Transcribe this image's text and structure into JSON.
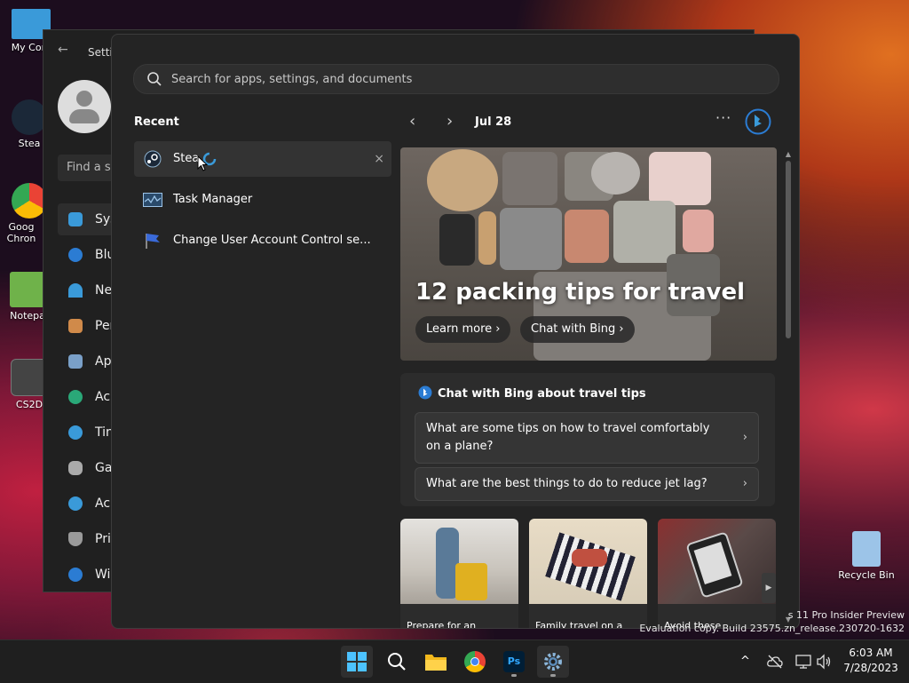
{
  "desktop": {
    "icons": [
      {
        "label": "My Com",
        "color": "#3a9ad9"
      },
      {
        "label": "Stea",
        "color": "#1b2838"
      },
      {
        "label": "Goog Chron",
        "color": "#e0e0e0"
      },
      {
        "label": "Notepa",
        "color": "#6fb24a"
      },
      {
        "label": "CS2D",
        "color": "#444444"
      },
      {
        "label": "Recycle Bin",
        "color": "#9cc4e8"
      }
    ]
  },
  "settings_window": {
    "title": "Setti",
    "find_placeholder": "Find a se",
    "nav": [
      {
        "label": "Sys",
        "color": "#3a9ad9"
      },
      {
        "label": "Blu",
        "color": "#2b7cd3"
      },
      {
        "label": "Ne",
        "color": "#3a9ad9"
      },
      {
        "label": "Per",
        "color": "#d08a4a"
      },
      {
        "label": "Ap",
        "color": "#7aa0c8"
      },
      {
        "label": "Ac",
        "color": "#2aa878"
      },
      {
        "label": "Tin",
        "color": "#3a9ad9"
      },
      {
        "label": "Ga",
        "color": "#aaaaaa"
      },
      {
        "label": "Ac",
        "color": "#3a9ad9"
      },
      {
        "label": "Pri",
        "color": "#9a9a9a"
      },
      {
        "label": "Wi",
        "color": "#2b7cd3"
      }
    ]
  },
  "start_menu": {
    "search_placeholder": "Search for apps, settings, and documents",
    "recent_heading": "Recent",
    "recent_items": [
      {
        "label": "Stea",
        "close": "×"
      },
      {
        "label": "Task Manager"
      },
      {
        "label": "Change User Account Control se..."
      }
    ],
    "date_label": "Jul 28",
    "more_label": "···",
    "hero": {
      "title": "12 packing tips for travel",
      "learn_more": "Learn more",
      "chat_with_bing": "Chat with Bing",
      "chevron": "›"
    },
    "chat_card": {
      "title": "Chat with Bing about travel tips",
      "questions": [
        "What are some tips on how to travel comfortably on a plane?",
        "What are the best things to do to reduce jet lag?"
      ],
      "chevron": "›"
    },
    "thumbnails": [
      {
        "caption": "Prepare for an",
        "color": "#c9c4bc"
      },
      {
        "caption": "Family travel on a",
        "color": "#d8cdb8"
      },
      {
        "caption": "Avoid these",
        "color": "#5a4a48"
      }
    ]
  },
  "watermark": {
    "line1": "s 11 Pro Insider Preview",
    "line2": "Evaluation copy. Build 23575.zn_release.230720-1632"
  },
  "taskbar": {
    "tray_chevron": "^",
    "time": "6:03 AM",
    "date": "7/28/2023"
  },
  "colors": {
    "accent": "#2b7cd3",
    "start_bg": "#242424"
  }
}
